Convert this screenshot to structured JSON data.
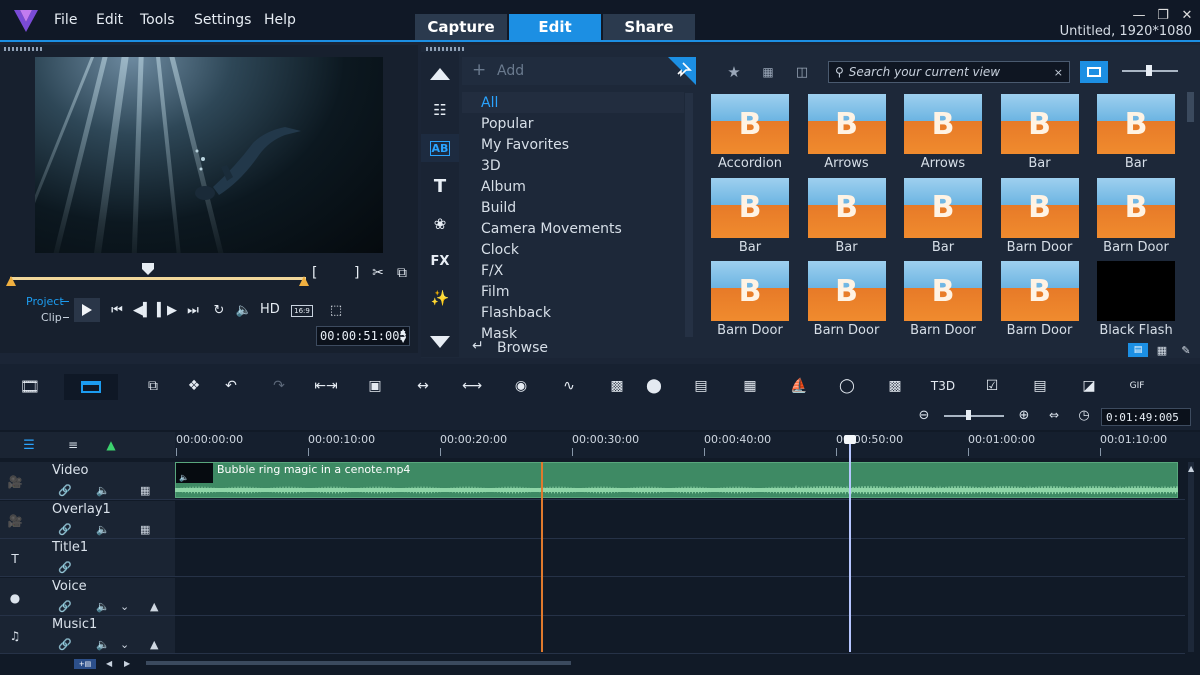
{
  "app": {
    "menu": [
      "File",
      "Edit",
      "Tools",
      "Settings",
      "Help"
    ],
    "tabs": [
      "Capture",
      "Edit",
      "Share"
    ],
    "active_tab": "Edit",
    "project_info": "Untitled, 1920*1080",
    "window_controls": [
      "minimize-icon",
      "restore-icon",
      "close-icon"
    ],
    "accent_color": "#1c8fe3"
  },
  "player": {
    "mode_project": "Project",
    "mode_clip": "Clip",
    "hd_label": "HD",
    "aspect_badge": "16:9",
    "timecode": "00:00:51:005",
    "trim_in": "[",
    "trim_out": "]"
  },
  "library": {
    "add_label": "Add",
    "browse_label": "Browse",
    "search_placeholder": "Search your current view",
    "categories": [
      "All",
      "Popular",
      "My Favorites",
      "3D",
      "Album",
      "Build",
      "Camera Movements",
      "Clock",
      "F/X",
      "Film",
      "Flashback",
      "Mask"
    ],
    "selected_category": "All",
    "side_icons": [
      "up-arrow-icon",
      "instant-project-icon",
      "transition-icon",
      "title-icon",
      "graphics-icon",
      "fx-icon",
      "particle-icon",
      "down-arrow-icon"
    ],
    "side_labels": {
      "transition": "AB",
      "title": "T",
      "fx": "FX"
    },
    "thumbnails": [
      {
        "label": "Accordion",
        "letter": "B"
      },
      {
        "label": "Arrows",
        "letter": "B"
      },
      {
        "label": "Arrows",
        "letter": "B"
      },
      {
        "label": "Bar",
        "letter": "B"
      },
      {
        "label": "Bar",
        "letter": "B"
      },
      {
        "label": "Bar",
        "letter": "B"
      },
      {
        "label": "Bar",
        "letter": "B"
      },
      {
        "label": "Bar",
        "letter": "B"
      },
      {
        "label": "Barn Door",
        "letter": "B"
      },
      {
        "label": "Barn Door",
        "letter": "B"
      },
      {
        "label": "Barn Door",
        "letter": "B"
      },
      {
        "label": "Barn Door",
        "letter": "B"
      },
      {
        "label": "Barn Door",
        "letter": "B"
      },
      {
        "label": "Barn Door",
        "letter": "B"
      },
      {
        "label": "Black Flash",
        "letter": ""
      }
    ]
  },
  "timeline": {
    "project_duration": "0:01:49:005",
    "ruler_labels": [
      "00:00:00:00",
      "00:00:10:00",
      "00:00:20:00",
      "00:00:30:00",
      "00:00:40:00",
      "00:00:50:00",
      "00:01:00:00",
      "00:01:10:00"
    ],
    "tracks": [
      {
        "name": "Video",
        "icon": "video-track-icon"
      },
      {
        "name": "Overlay1",
        "icon": "overlay-track-icon"
      },
      {
        "name": "Title1",
        "icon": "title-track-icon"
      },
      {
        "name": "Voice",
        "icon": "voice-track-icon"
      },
      {
        "name": "Music1",
        "icon": "music-track-icon"
      }
    ],
    "clip_name": "Bubble ring magic in a cenote.mp4",
    "toolbar_labels": {
      "title3d": "T3D",
      "gif": "GIF"
    }
  }
}
